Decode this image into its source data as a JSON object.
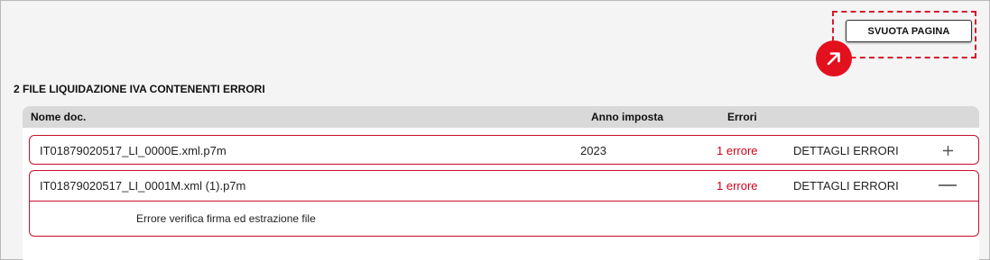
{
  "toolbar": {
    "clear_page_label": "SVUOTA PAGINA"
  },
  "section": {
    "title": "2 FILE LIQUIDAZIONE IVA CONTENENTI ERRORI"
  },
  "table": {
    "headers": {
      "name": "Nome doc.",
      "year": "Anno imposta",
      "errors": "Errori"
    },
    "rows": [
      {
        "name": "IT01879020517_LI_0000E.xml.p7m",
        "year": "2023",
        "errors": "1 errore",
        "details_label": "DETTAGLI ERRORI",
        "toggle": "plus-icon"
      },
      {
        "name": "IT01879020517_LI_0001M.xml (1).p7m",
        "year": "",
        "errors": "1 errore",
        "details_label": "DETTAGLI ERRORI",
        "toggle": "minus-icon",
        "detail": "Errore verifica firma ed estrazione file"
      }
    ]
  },
  "colors": {
    "accent": "#e3101e",
    "error_text": "#d0021b",
    "row_border": "#c8102e",
    "header_bg": "#d9d9d9",
    "page_bg": "#f4f4f4"
  }
}
